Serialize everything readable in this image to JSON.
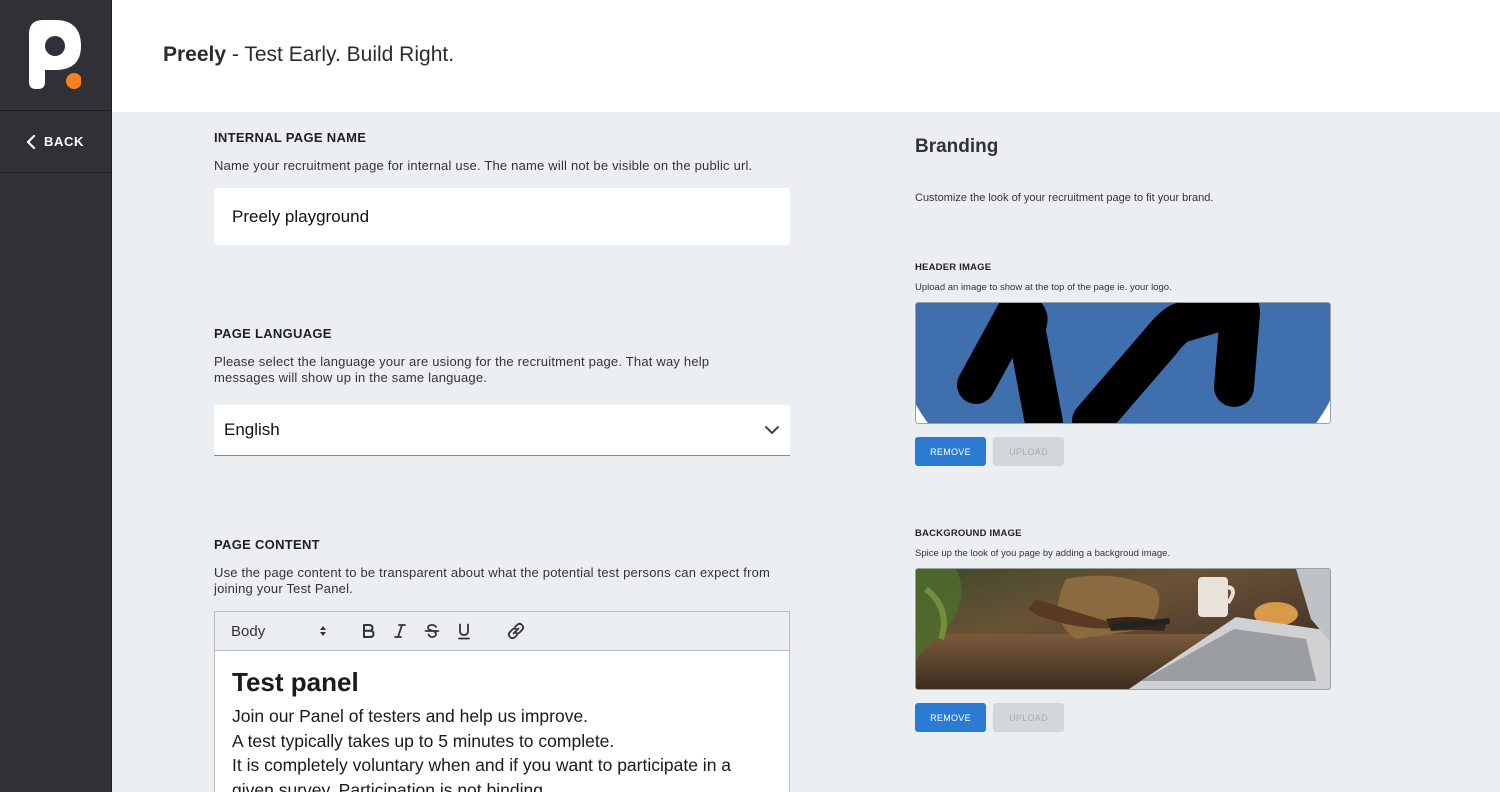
{
  "app": {
    "brand": "Preely",
    "tagline": " - Test Early. Build Right."
  },
  "sidebar": {
    "back_label": "BACK"
  },
  "internal_name": {
    "label": "INTERNAL PAGE NAME",
    "description": "Name your recruitment page for internal use. The name will not be visible on the public url.",
    "value": "Preely playground"
  },
  "language": {
    "label": "PAGE LANGUAGE",
    "description": "Please select the language your are usiong for the recruitment page. That way help messages will show up in the same language.",
    "value": "English"
  },
  "content": {
    "label": "PAGE CONTENT",
    "description": "Use the page content to be transparent about what the potential test persons can expect from joining your Test Panel.",
    "toolbar": {
      "style_value": "Body",
      "icons": [
        "bold-icon",
        "italic-icon",
        "strikethrough-icon",
        "underline-icon",
        "link-icon"
      ]
    },
    "heading": "Test panel",
    "lines": [
      "Join our Panel of testers and help us improve.",
      "A test typically takes up to 5 minutes to complete.",
      "It is completely voluntary when and if you want to participate in a given survey. Participation is not binding."
    ]
  },
  "branding": {
    "title": "Branding",
    "description": "Customize the look of your recruitment page to fit your brand.",
    "header_image": {
      "label": "HEADER IMAGE",
      "description": "Upload an image to show at the top of the page ie. your logo.",
      "remove_label": "REMOVE",
      "upload_label": "UPLOAD"
    },
    "background_image": {
      "label": "BACKGROUND IMAGE",
      "description": "Spice up the look of you page by adding a backgroud image.",
      "remove_label": "REMOVE",
      "upload_label": "UPLOAD"
    }
  },
  "colors": {
    "sidebar": "#2f3136",
    "accent": "#2c7bd2",
    "logo_dot": "#f5821f",
    "header_logo_blue": "#3f6fad"
  }
}
